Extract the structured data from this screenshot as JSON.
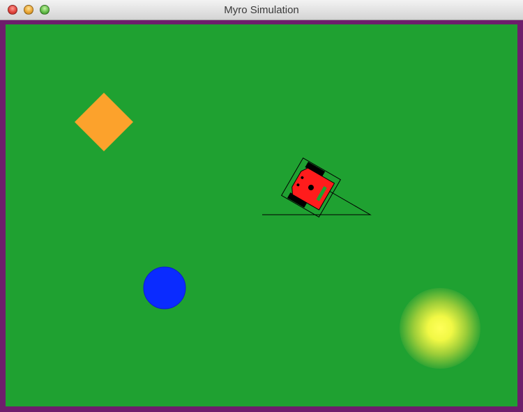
{
  "window": {
    "title": "Myro Simulation"
  },
  "colors": {
    "field": "#1fa131",
    "border": "#6e1e6c",
    "diamond": "#fca22c",
    "circle": "#0a2bff",
    "light_center": "#ffff5a",
    "robot_body": "#ff1c1c"
  },
  "scene": {
    "objects": [
      "orange-diamond",
      "blue-circle",
      "yellow-light",
      "robot"
    ]
  }
}
